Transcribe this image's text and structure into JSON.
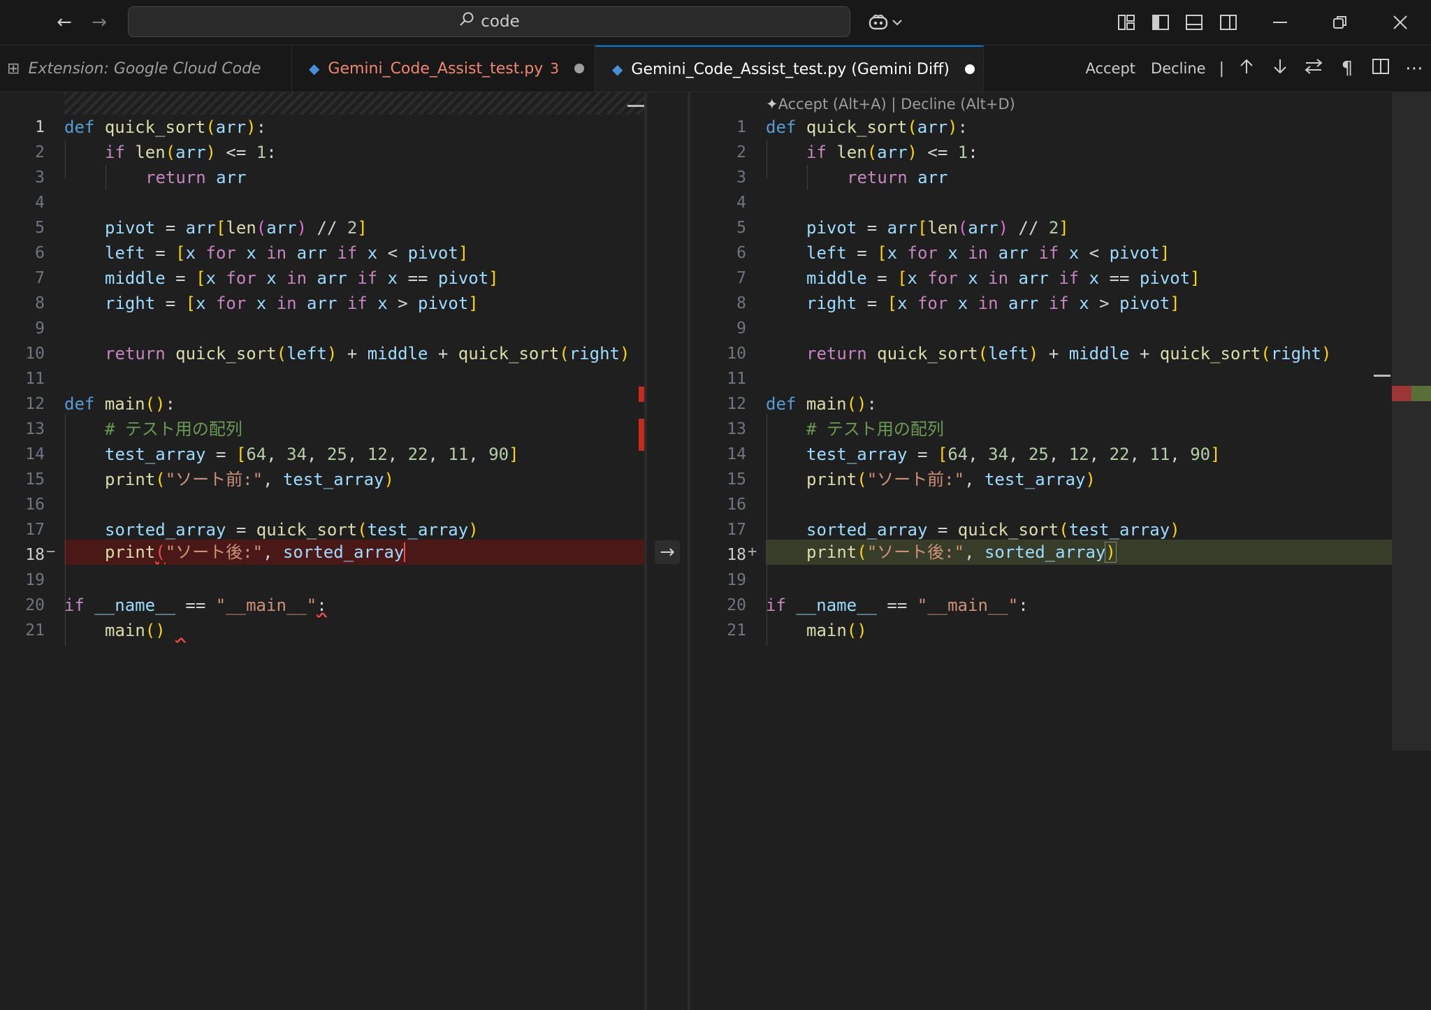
{
  "titlebar": {
    "search_text": "code",
    "icons": [
      "arrow-left-icon",
      "arrow-right-icon",
      "search-icon",
      "copilot-icon",
      "chevron-down-icon",
      "customize-layout-icon",
      "toggle-primary-sidebar-icon",
      "toggle-panel-icon",
      "toggle-secondary-sidebar-icon",
      "minimize-icon",
      "restore-icon",
      "close-icon"
    ]
  },
  "tabs": [
    {
      "label": "Extension: Google Cloud Code"
    },
    {
      "label": "Gemini_Code_Assist_test.py",
      "count": "3",
      "modified": true
    },
    {
      "label": "Gemini_Code_Assist_test.py (Gemini Diff)",
      "modified": true,
      "active": true
    }
  ],
  "tab_actions": {
    "accept_label": "Accept",
    "decline_label": "Decline",
    "separator": "|"
  },
  "codelens": {
    "accept": "Accept (Alt+A)",
    "separator": " | ",
    "decline": "Decline (Alt+D)"
  },
  "editor": {
    "line_numbers": [
      "1",
      "2",
      "3",
      "4",
      "5",
      "6",
      "7",
      "8",
      "9",
      "10",
      "11",
      "12",
      "13",
      "14",
      "15",
      "16",
      "17",
      "18",
      "19",
      "20",
      "21"
    ],
    "left_changed_line_marker": "−",
    "right_changed_line_marker": "+",
    "comment_text": "# テスト用の配列",
    "print_before_str": "\"ソート前:\"",
    "print_after_str": "\"ソート後:\""
  },
  "colors": {
    "deleted_line": "#4b1818",
    "inserted_line": "#373d29",
    "accent": "#0078d4"
  }
}
